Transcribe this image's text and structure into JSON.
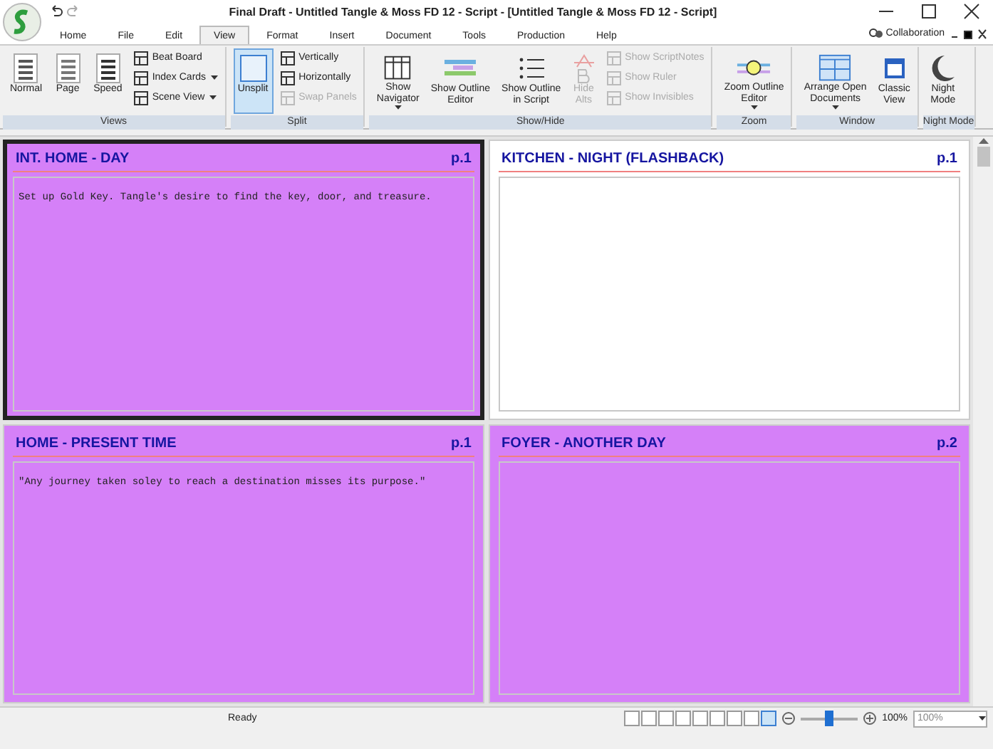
{
  "window": {
    "title": "Final Draft - Untitled Tangle & Moss FD 12 - Script - [Untitled Tangle & Moss FD 12 - Script]"
  },
  "menu_tabs": [
    {
      "label": "Home",
      "selected": false
    },
    {
      "label": "File",
      "selected": false
    },
    {
      "label": "Edit",
      "selected": false
    },
    {
      "label": "View",
      "selected": true
    },
    {
      "label": "Format",
      "selected": false
    },
    {
      "label": "Insert",
      "selected": false
    },
    {
      "label": "Document",
      "selected": false
    },
    {
      "label": "Tools",
      "selected": false
    },
    {
      "label": "Production",
      "selected": false
    },
    {
      "label": "Help",
      "selected": false
    }
  ],
  "collaboration": "Collaboration",
  "ribbon_groups": [
    {
      "name": "Views",
      "buttons": [
        {
          "kind": "large",
          "label": "Normal",
          "selected": false,
          "disabled": false,
          "dropdown": false
        },
        {
          "kind": "large",
          "label": "Page",
          "selected": false,
          "disabled": false,
          "dropdown": false
        },
        {
          "kind": "large",
          "label": "Speed",
          "selected": false,
          "disabled": false,
          "dropdown": false
        },
        {
          "kind": "small",
          "label": "Beat Board",
          "selected": false,
          "disabled": false,
          "dropdown": false
        },
        {
          "kind": "small",
          "label": "Index Cards",
          "selected": false,
          "disabled": false,
          "dropdown": true
        },
        {
          "kind": "small",
          "label": "Scene View",
          "selected": false,
          "disabled": false,
          "dropdown": true
        }
      ]
    },
    {
      "name": "Split",
      "buttons": [
        {
          "kind": "large",
          "label": "Unsplit",
          "selected": true,
          "disabled": false,
          "dropdown": false
        },
        {
          "kind": "small",
          "label": "Vertically",
          "selected": false,
          "disabled": false,
          "dropdown": false
        },
        {
          "kind": "small",
          "label": "Horizontally",
          "selected": false,
          "disabled": false,
          "dropdown": false
        },
        {
          "kind": "small",
          "label": "Swap Panels",
          "selected": false,
          "disabled": true,
          "dropdown": false
        }
      ]
    },
    {
      "name": "Show/Hide",
      "buttons": [
        {
          "kind": "large",
          "label": "Show\nNavigator",
          "selected": false,
          "disabled": false,
          "dropdown": true
        },
        {
          "kind": "large",
          "label": "Show Outline\nEditor",
          "selected": false,
          "disabled": false,
          "dropdown": false
        },
        {
          "kind": "large",
          "label": "Show Outline\nin Script",
          "selected": false,
          "disabled": false,
          "dropdown": false
        },
        {
          "kind": "large",
          "label": "Hide\nAlts",
          "selected": false,
          "disabled": true,
          "dropdown": false
        },
        {
          "kind": "small",
          "label": "Show ScriptNotes",
          "selected": false,
          "disabled": true,
          "dropdown": false
        },
        {
          "kind": "small",
          "label": "Show Ruler",
          "selected": false,
          "disabled": true,
          "dropdown": false
        },
        {
          "kind": "small",
          "label": "Show Invisibles",
          "selected": false,
          "disabled": true,
          "dropdown": false
        }
      ]
    },
    {
      "name": "Zoom",
      "buttons": [
        {
          "kind": "large",
          "label": "Zoom Outline\nEditor",
          "selected": false,
          "disabled": false,
          "dropdown": true
        }
      ]
    },
    {
      "name": "Window",
      "buttons": [
        {
          "kind": "large",
          "label": "Arrange Open\nDocuments",
          "selected": false,
          "disabled": false,
          "dropdown": true
        },
        {
          "kind": "large",
          "label": "Classic\nView",
          "selected": false,
          "disabled": false,
          "dropdown": false
        }
      ]
    },
    {
      "name": "Night Mode",
      "buttons": [
        {
          "kind": "large",
          "label": "Night\nMode",
          "selected": false,
          "disabled": false,
          "dropdown": false
        }
      ]
    }
  ],
  "cards": [
    {
      "heading": "INT. HOME - DAY",
      "page": "p.1",
      "text": "Set up Gold Key. Tangle's desire to find the key, door, and treasure.",
      "color": "#d580f8",
      "selected": true
    },
    {
      "heading": "KITCHEN - NIGHT (FLASHBACK)",
      "page": "p.1",
      "color": "#ffffff",
      "selected": false
    },
    {
      "heading": "HOME - PRESENT TIME",
      "page": "p.1",
      "text": "\"Any journey taken soley to reach a destination misses its purpose.\"",
      "color": "#d580f8",
      "selected": false
    },
    {
      "heading": "FOYER - ANOTHER DAY",
      "page": "p.2",
      "color": "#d580f8",
      "selected": false
    }
  ],
  "status_bar": {
    "status": "Ready",
    "view_buttons": [
      {
        "selected": false
      },
      {
        "selected": false
      },
      {
        "selected": false
      },
      {
        "selected": false
      },
      {
        "selected": false
      },
      {
        "selected": false
      },
      {
        "selected": false
      },
      {
        "selected": false
      },
      {
        "selected": true
      }
    ],
    "zoom": {
      "level": 0.5,
      "reading": "100%",
      "combo": "100%"
    }
  }
}
